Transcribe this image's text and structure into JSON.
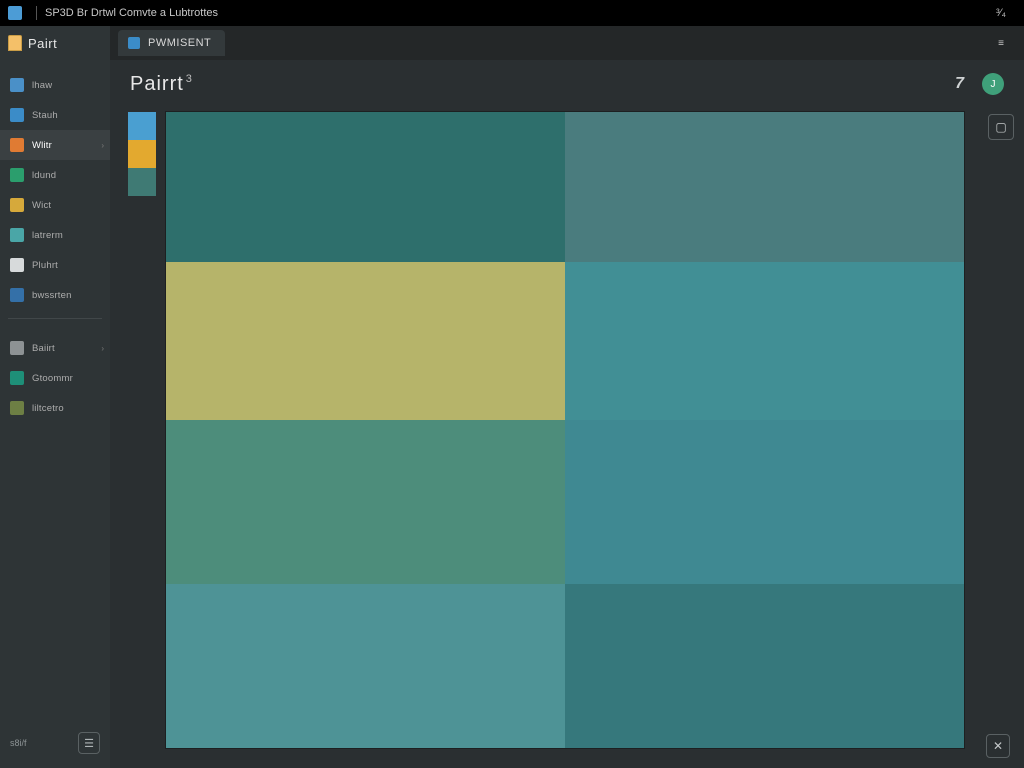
{
  "titlebar": {
    "text": "SP3D  Br  Drtwl  Comvte a  Lubtrottes",
    "right": "³⁄₄"
  },
  "sidebar": {
    "app_label": "Pairt",
    "items": [
      {
        "label": "lhaw",
        "color": "#4a90c8"
      },
      {
        "label": "Stauh",
        "color": "#3b8cc8"
      },
      {
        "label": "Wlitr",
        "color": "#e07b33"
      },
      {
        "label": "ldund",
        "color": "#2b9e6d"
      },
      {
        "label": "Wict",
        "color": "#d6a93b"
      },
      {
        "label": "latrerm",
        "color": "#4aa6a7"
      },
      {
        "label": "Pluhrt",
        "color": "#d7dadb"
      },
      {
        "label": "bwssrten",
        "color": "#3470a8"
      }
    ],
    "group2": [
      {
        "label": "Baiirt",
        "color": "#8d9294"
      },
      {
        "label": "Gtoommr",
        "color": "#1e8f78"
      },
      {
        "label": "liltcetro",
        "color": "#6d7f44"
      }
    ],
    "footer_text": "s8i/f"
  },
  "tab": {
    "label": "PWMISENT"
  },
  "tab_right": "≡",
  "doc": {
    "title": "Pairrt",
    "sup": "3"
  },
  "header_action": "7",
  "avatar_initial": "J",
  "swatches": [
    "#4a9fd1",
    "#e3a92f",
    "#3f7a74"
  ],
  "canvas_cells": [
    "#2e6f6c",
    "#4a7c7e",
    "#b6b46a",
    "#418f95",
    "#4d8d7b",
    "#3f8992",
    "#4e9396",
    "#36787c"
  ],
  "rtool": {
    "save": "▢"
  },
  "br_btn": "✕"
}
